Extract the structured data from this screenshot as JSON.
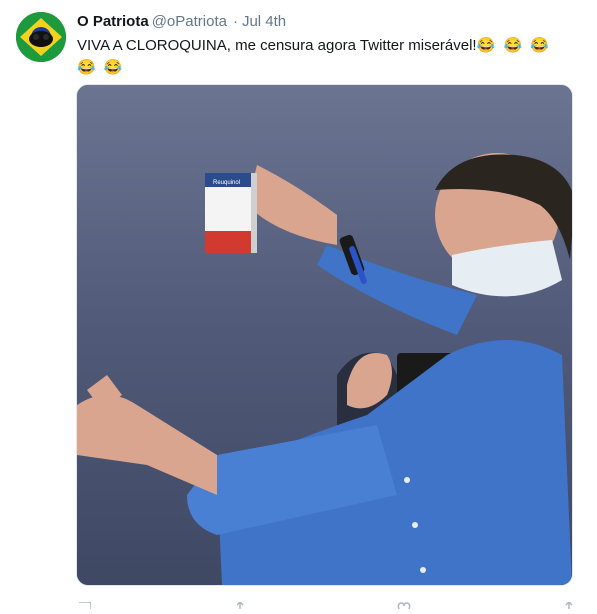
{
  "tweet": {
    "display_name": "O Patriota",
    "handle": "@oPatriota",
    "separator": "·",
    "date": "Jul 4th",
    "text": "VIVA A CLOROQUINA, me censura agora Twitter miserável!",
    "emoji_inline": "😂 😂 😂",
    "emoji_line2": "😂 😂"
  },
  "media": {
    "alt": "photo",
    "pill_box_label": "Reuquinol"
  },
  "actions": {
    "icons": [
      "reply-icon",
      "retweet-icon",
      "like-icon",
      "share-icon"
    ]
  },
  "colors": {
    "name": "#14171a",
    "secondary": "#657786",
    "media_sky": "#4a5470",
    "shirt": "#3f74c8"
  }
}
